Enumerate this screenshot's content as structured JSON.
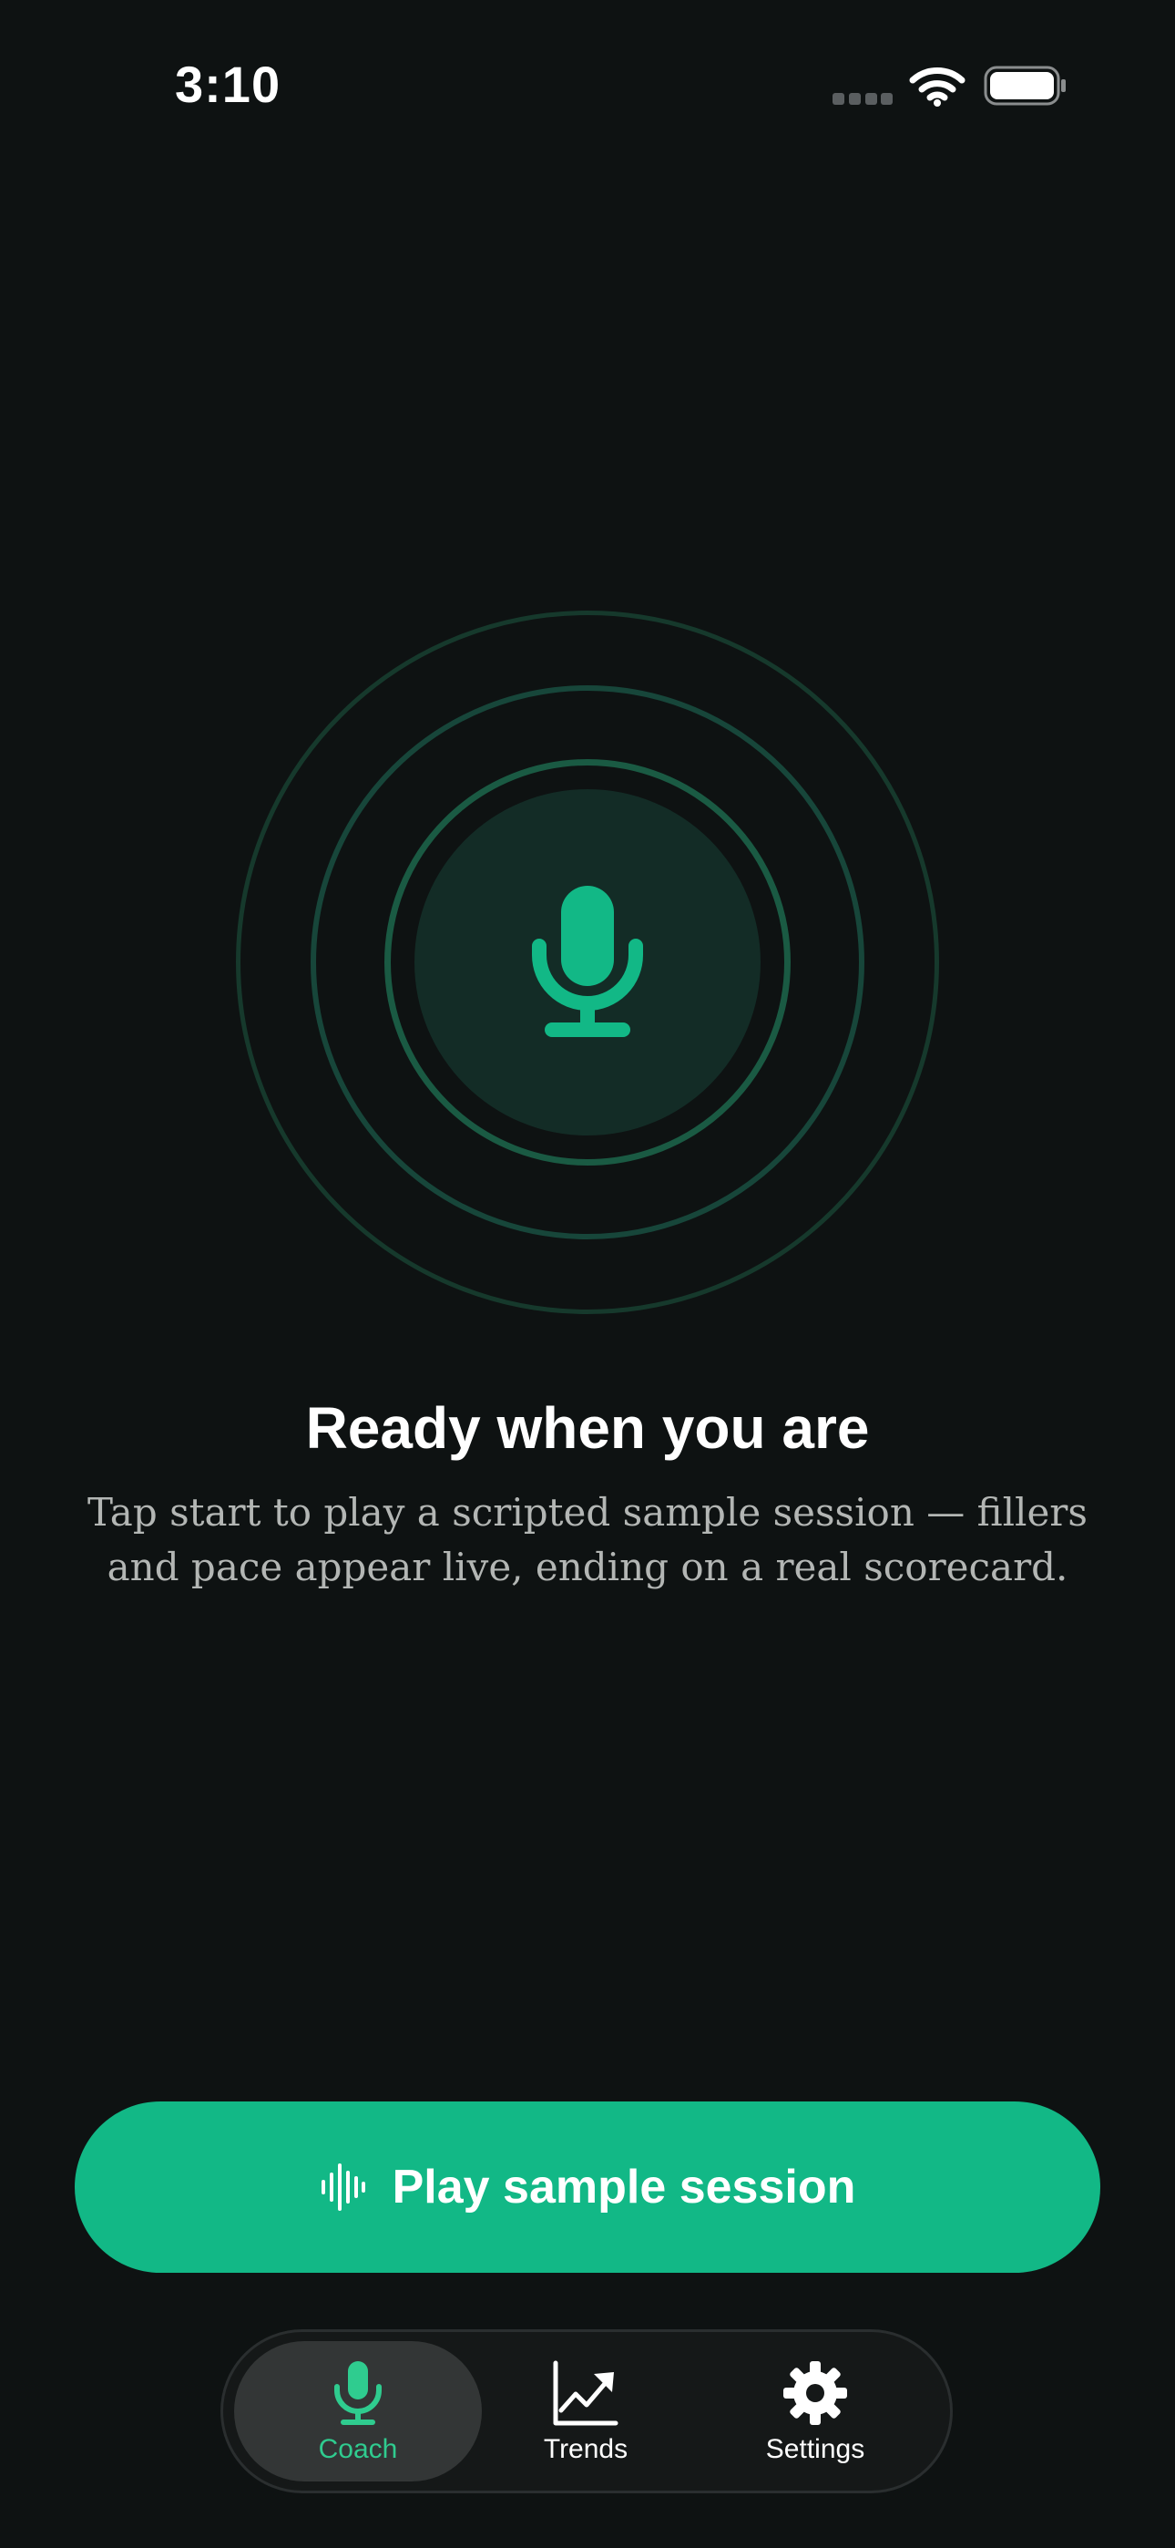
{
  "status_bar": {
    "time": "3:10",
    "icons": [
      "cellular-signal-icon",
      "wifi-icon",
      "battery-icon"
    ]
  },
  "hero": {
    "icon": "microphone-icon",
    "title": "Ready when you are",
    "description": "Tap start to play a scripted sample session — fillers and pace appear live, ending on a real scorecard."
  },
  "primary_action": {
    "icon": "waveform-icon",
    "label": "Play sample session"
  },
  "tab_bar": {
    "tabs": [
      {
        "label": "Coach",
        "icon": "microphone-icon",
        "selected": true
      },
      {
        "label": "Trends",
        "icon": "trend-chart-icon",
        "selected": false
      },
      {
        "label": "Settings",
        "icon": "gear-icon",
        "selected": false
      }
    ]
  },
  "colors": {
    "background": "#0e1212",
    "accent": "#12b886",
    "accent_text": "#2fcc8f",
    "ring": "#1a5a43",
    "disc": "#132c26"
  }
}
